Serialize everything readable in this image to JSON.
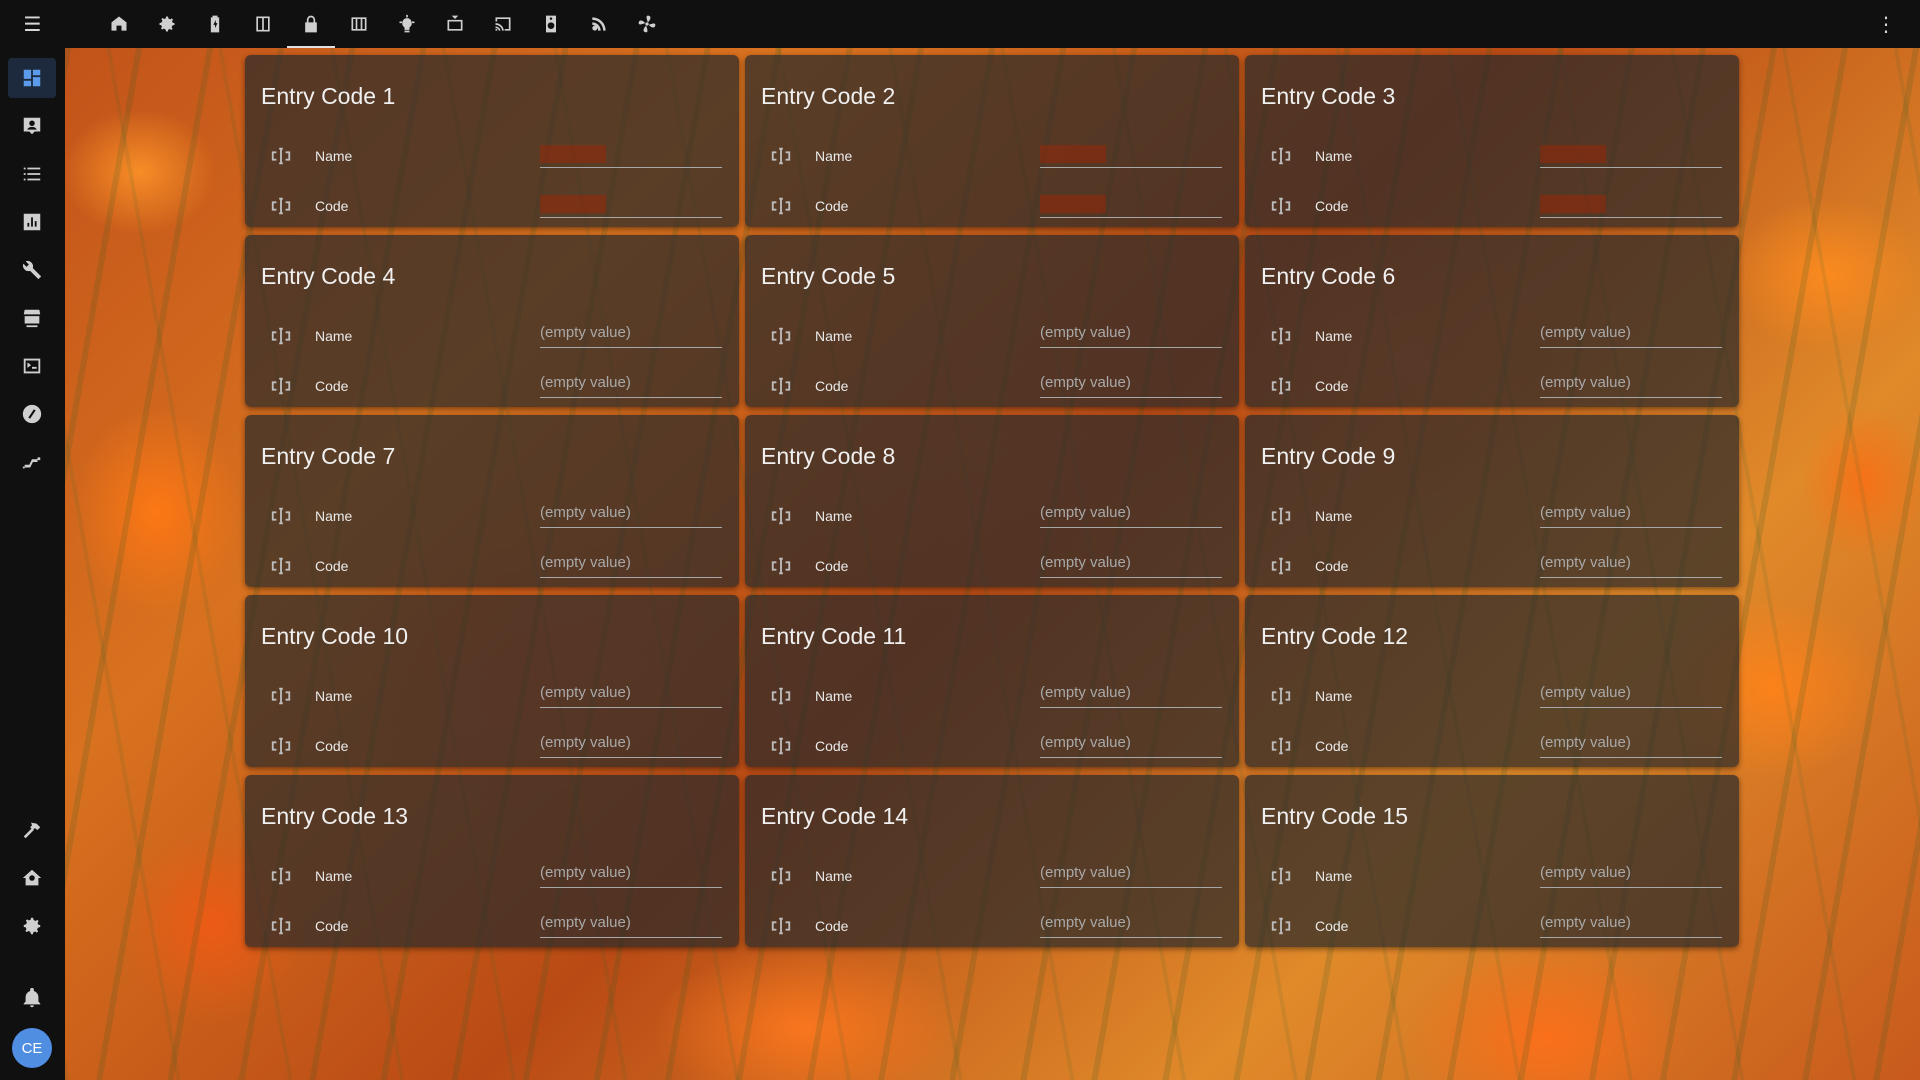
{
  "topbar": {
    "menu_icon": "menu-icon",
    "tabs": [
      {
        "icon": "home-icon"
      },
      {
        "icon": "cog-icon"
      },
      {
        "icon": "battery-icon"
      },
      {
        "icon": "door-icon"
      },
      {
        "icon": "lock-icon",
        "active": true
      },
      {
        "icon": "blinds-icon"
      },
      {
        "icon": "lightbulb-icon"
      },
      {
        "icon": "tv-icon"
      },
      {
        "icon": "cast-icon"
      },
      {
        "icon": "water-heater-icon"
      },
      {
        "icon": "rss-icon"
      },
      {
        "icon": "fan-icon"
      }
    ],
    "more_icon": "dots-vertical-icon"
  },
  "sidebar": {
    "items": [
      "dashboard-icon",
      "map-account-icon",
      "logbook-icon",
      "history-icon",
      "wrench-icon",
      "hacs-icon",
      "terminal-icon",
      "vscode-icon",
      "node-red-icon"
    ],
    "bottom_items": [
      "hammer-icon",
      "supervisor-icon",
      "settings-icon",
      "bell-icon"
    ],
    "avatar": "CE"
  },
  "cards": [
    {
      "title": "Entry Code 1",
      "name_label": "Name",
      "code_label": "Code",
      "name_value": "",
      "code_value": "",
      "masked": true
    },
    {
      "title": "Entry Code 2",
      "name_label": "Name",
      "code_label": "Code",
      "name_value": "",
      "code_value": "",
      "masked": true
    },
    {
      "title": "Entry Code 3",
      "name_label": "Name",
      "code_label": "Code",
      "name_value": "",
      "code_value": "",
      "masked": true
    },
    {
      "title": "Entry Code 4",
      "name_label": "Name",
      "code_label": "Code",
      "name_value": "(empty value)",
      "code_value": "(empty value)"
    },
    {
      "title": "Entry Code 5",
      "name_label": "Name",
      "code_label": "Code",
      "name_value": "(empty value)",
      "code_value": "(empty value)"
    },
    {
      "title": "Entry Code 6",
      "name_label": "Name",
      "code_label": "Code",
      "name_value": "(empty value)",
      "code_value": "(empty value)"
    },
    {
      "title": "Entry Code 7",
      "name_label": "Name",
      "code_label": "Code",
      "name_value": "(empty value)",
      "code_value": "(empty value)"
    },
    {
      "title": "Entry Code 8",
      "name_label": "Name",
      "code_label": "Code",
      "name_value": "(empty value)",
      "code_value": "(empty value)"
    },
    {
      "title": "Entry Code 9",
      "name_label": "Name",
      "code_label": "Code",
      "name_value": "(empty value)",
      "code_value": "(empty value)"
    },
    {
      "title": "Entry Code 10",
      "name_label": "Name",
      "code_label": "Code",
      "name_value": "(empty value)",
      "code_value": "(empty value)"
    },
    {
      "title": "Entry Code 11",
      "name_label": "Name",
      "code_label": "Code",
      "name_value": "(empty value)",
      "code_value": "(empty value)"
    },
    {
      "title": "Entry Code 12",
      "name_label": "Name",
      "code_label": "Code",
      "name_value": "(empty value)",
      "code_value": "(empty value)"
    },
    {
      "title": "Entry Code 13",
      "name_label": "Name",
      "code_label": "Code",
      "name_value": "(empty value)",
      "code_value": "(empty value)"
    },
    {
      "title": "Entry Code 14",
      "name_label": "Name",
      "code_label": "Code",
      "name_value": "(empty value)",
      "code_value": "(empty value)"
    },
    {
      "title": "Entry Code 15",
      "name_label": "Name",
      "code_label": "Code",
      "name_value": "(empty value)",
      "code_value": "(empty value)"
    }
  ],
  "colors": {
    "accent": "#5b9bea",
    "card_bg": "#2a2a2a",
    "bar_bg": "#101010"
  }
}
